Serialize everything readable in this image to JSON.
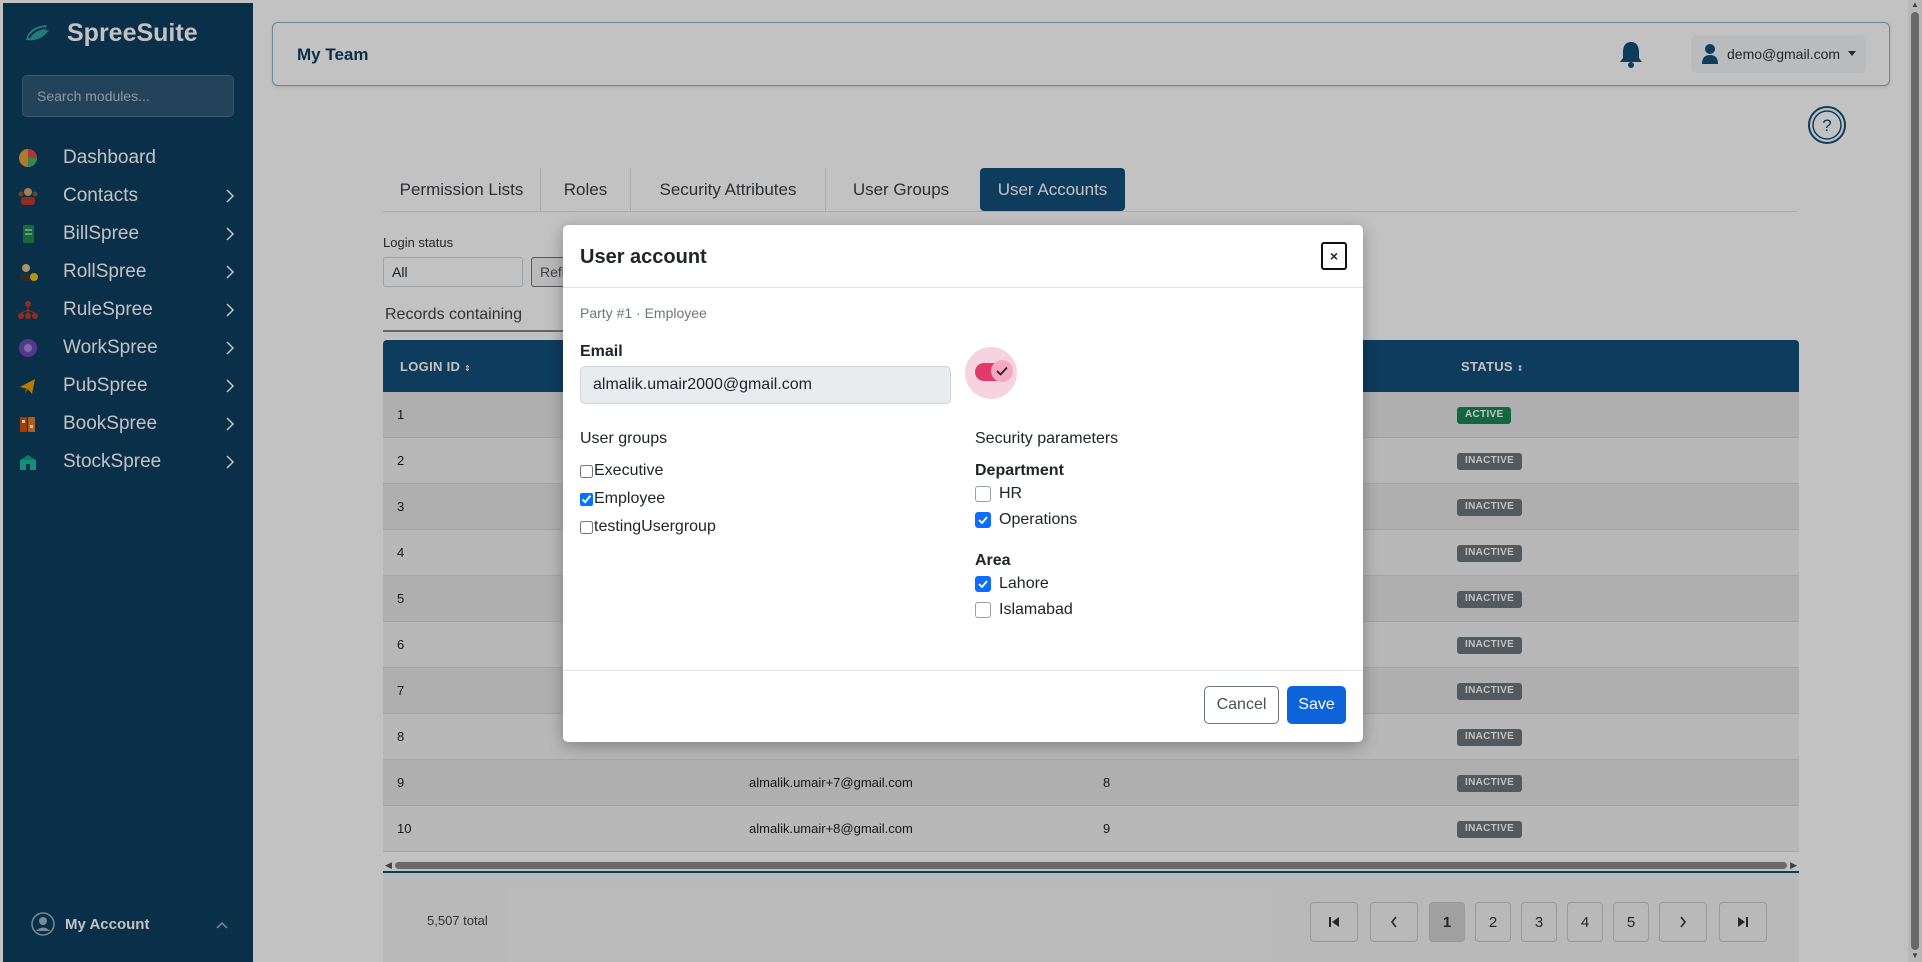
{
  "sidebar": {
    "brand": "SpreeSuite",
    "search_placeholder": "Search modules...",
    "items": [
      {
        "label": "Dashboard",
        "icon": "dashboard-icon"
      },
      {
        "label": "Contacts",
        "icon": "contacts-icon"
      },
      {
        "label": "BillSpree",
        "icon": "bill-icon"
      },
      {
        "label": "RollSpree",
        "icon": "roll-icon"
      },
      {
        "label": "RuleSpree",
        "icon": "rule-icon"
      },
      {
        "label": "WorkSpree",
        "icon": "work-icon"
      },
      {
        "label": "PubSpree",
        "icon": "pub-icon"
      },
      {
        "label": "BookSpree",
        "icon": "book-icon"
      },
      {
        "label": "StockSpree",
        "icon": "stock-icon"
      }
    ],
    "account_label": "My Account"
  },
  "header": {
    "title": "My Team",
    "user_email": "demo@gmail.com"
  },
  "tabs": [
    {
      "label": "Permission Lists"
    },
    {
      "label": "Roles"
    },
    {
      "label": "Security Attributes"
    },
    {
      "label": "User Groups"
    },
    {
      "label": "User Accounts",
      "active": true
    }
  ],
  "filters": {
    "login_status_label": "Login status",
    "login_status_value": "All",
    "refresh_label": "Refi",
    "records_containing": "Records containing"
  },
  "table": {
    "columns": [
      "LOGIN ID",
      "STATUS"
    ],
    "rows": [
      {
        "id": "1",
        "email": "",
        "party": "",
        "status": "ACTIVE"
      },
      {
        "id": "2",
        "email": "",
        "party": "",
        "status": "INACTIVE"
      },
      {
        "id": "3",
        "email": "",
        "party": "",
        "status": "INACTIVE"
      },
      {
        "id": "4",
        "email": "",
        "party": "",
        "status": "INACTIVE"
      },
      {
        "id": "5",
        "email": "",
        "party": "",
        "status": "INACTIVE"
      },
      {
        "id": "6",
        "email": "",
        "party": "",
        "status": "INACTIVE"
      },
      {
        "id": "7",
        "email": "",
        "party": "",
        "status": "INACTIVE"
      },
      {
        "id": "8",
        "email": "",
        "party": "",
        "status": "INACTIVE"
      },
      {
        "id": "9",
        "email": "almalik.umair+7@gmail.com",
        "party": "8",
        "status": "INACTIVE"
      },
      {
        "id": "10",
        "email": "almalik.umair+8@gmail.com",
        "party": "9",
        "status": "INACTIVE"
      }
    ],
    "total": "5,507 total"
  },
  "pagination": {
    "pages": [
      "1",
      "2",
      "3",
      "4",
      "5"
    ],
    "current": "1"
  },
  "modal": {
    "title": "User account",
    "close_label": "×",
    "subtitle": "Party #1 · Employee",
    "email_label": "Email",
    "email_value": "almalik.umair2000@gmail.com",
    "active_toggle": true,
    "user_groups_title": "User groups",
    "user_groups": [
      {
        "label": "Executive",
        "checked": false
      },
      {
        "label": "Employee",
        "checked": true
      },
      {
        "label": "testingUsergroup",
        "checked": false
      }
    ],
    "security_title": "Security parameters",
    "department_label": "Department",
    "departments": [
      {
        "label": "HR",
        "checked": false
      },
      {
        "label": "Operations",
        "checked": true
      }
    ],
    "area_label": "Area",
    "areas": [
      {
        "label": "Lahore",
        "checked": true
      },
      {
        "label": "Islamabad",
        "checked": false
      }
    ],
    "cancel_label": "Cancel",
    "save_label": "Save"
  },
  "colors": {
    "sidebar_bg": "#0e3f5f",
    "primary": "#134f7b",
    "save_blue": "#0d63d9",
    "toggle_pink": "#e23a6a",
    "active_green": "#198754",
    "inactive_gray": "#6c757d"
  }
}
